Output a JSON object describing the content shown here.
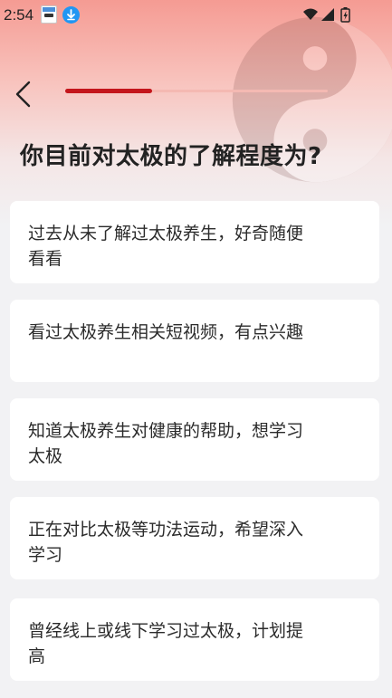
{
  "status_bar": {
    "time": "2:54",
    "icons": [
      "app-notification-icon",
      "download-notification-icon",
      "wifi-icon",
      "signal-icon",
      "battery-icon"
    ]
  },
  "header": {
    "progress_fraction": 0.33
  },
  "question": "你目前对太极的了解程度为?",
  "options": [
    {
      "label": "过去从未了解过太极养生，好奇随便看看"
    },
    {
      "label": "看过太极养生相关短视频，有点兴趣"
    },
    {
      "label": "知道太极养生对健康的帮助，想学习太极"
    },
    {
      "label": "正在对比太极等功法运动，希望深入学习"
    },
    {
      "label": "曾经线上或线下学习过太极，计划提高"
    }
  ],
  "colors": {
    "accent": "#c4161c",
    "header_gradient_top": "#f59b93",
    "page_background": "#f2f2f4"
  }
}
